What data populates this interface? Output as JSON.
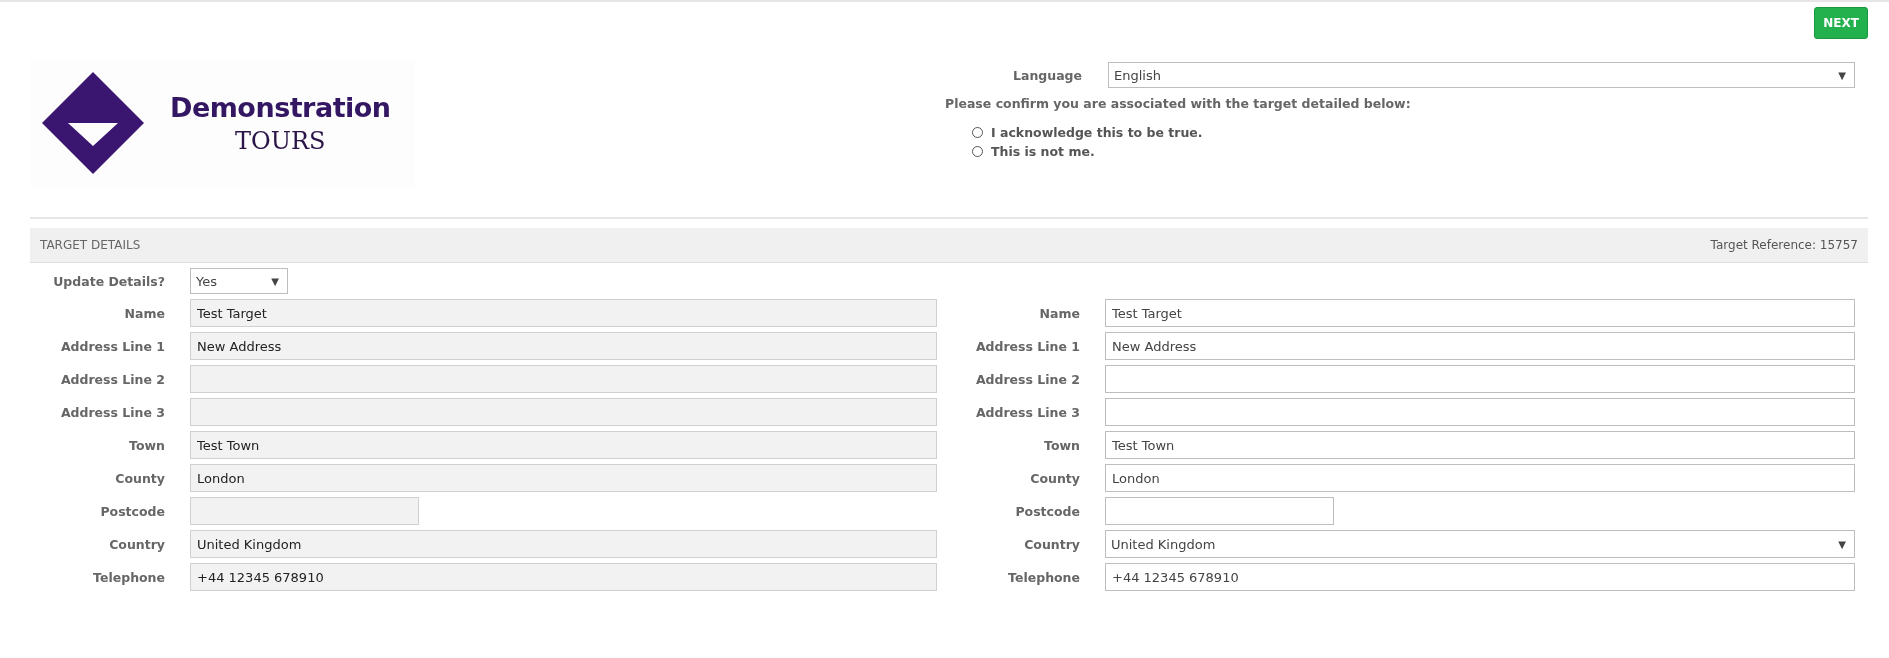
{
  "next_button": "NEXT",
  "logo": {
    "title": "Demonstration",
    "subtitle": "TOURS"
  },
  "language": {
    "label": "Language",
    "value": "English",
    "caret": "▼"
  },
  "confirmation": {
    "prompt": "Please confirm you are associated with the target detailed below:",
    "options": [
      {
        "label": "I acknowledge this to be true.",
        "selected": false
      },
      {
        "label": "This is not me.",
        "selected": false
      }
    ]
  },
  "section": {
    "title": "TARGET DETAILS",
    "reference": "Target Reference: 15757"
  },
  "update_details": {
    "label": "Update Details?",
    "value": "Yes",
    "caret": "▼"
  },
  "current_details": [
    {
      "label": "Name",
      "value": "Test Target",
      "kind": "text",
      "disabled": true
    },
    {
      "label": "Address Line 1",
      "value": "New Address",
      "kind": "text",
      "disabled": true
    },
    {
      "label": "Address Line 2",
      "kind": "text",
      "disabled": true
    },
    {
      "label": "Address Line 3",
      "kind": "text",
      "disabled": true
    },
    {
      "label": "Town",
      "value": "Test Town",
      "kind": "text",
      "disabled": true
    },
    {
      "label": "County",
      "value": "London",
      "kind": "text",
      "disabled": true
    },
    {
      "label": "Postcode",
      "kind": "short",
      "disabled": true
    },
    {
      "label": "Country",
      "value": "United Kingdom",
      "kind": "text",
      "disabled": true
    },
    {
      "label": "Telephone",
      "value": "+44 12345 678910",
      "kind": "text",
      "disabled": true
    }
  ],
  "new_details": [
    {
      "label": "Name",
      "value": "Test Target",
      "kind": "text",
      "disabled": false
    },
    {
      "label": "Address Line 1",
      "value": "New Address",
      "kind": "text",
      "disabled": false
    },
    {
      "label": "Address Line 2",
      "kind": "text",
      "disabled": false
    },
    {
      "label": "Address Line 3",
      "kind": "text",
      "disabled": false
    },
    {
      "label": "Town",
      "value": "Test Town",
      "kind": "text",
      "disabled": false
    },
    {
      "label": "County",
      "value": "London",
      "kind": "text",
      "disabled": false
    },
    {
      "label": "Postcode",
      "kind": "short",
      "disabled": false
    },
    {
      "label": "Country",
      "value": "United Kingdom",
      "kind": "select",
      "caret": "▼",
      "disabled": false
    },
    {
      "label": "Telephone",
      "value": "+44 12345 678910",
      "kind": "text",
      "disabled": false
    }
  ]
}
